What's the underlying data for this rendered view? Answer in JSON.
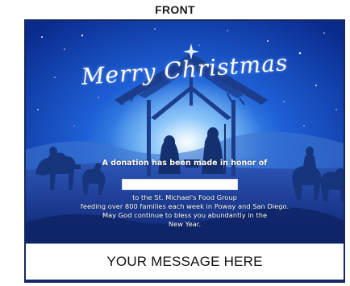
{
  "header": {
    "label": "FRONT"
  },
  "card": {
    "greeting": "Merry Christmas",
    "donation_line": "A donation has been made in honor of",
    "honor_field_value": "",
    "body_lines": [
      "to the St. Michael's Food Group",
      "feeding over 800 families each week in Poway and San Diego.",
      "May God continue to bless you abundantly in the",
      "New Year."
    ],
    "message_placeholder": "YOUR MESSAGE HERE"
  },
  "colors": {
    "sky_top": "#0a2a8c",
    "sky_mid": "#1e5fd6",
    "glow": "#a9d3ff",
    "silhouette": "#1a3a86",
    "border": "#16285f"
  }
}
